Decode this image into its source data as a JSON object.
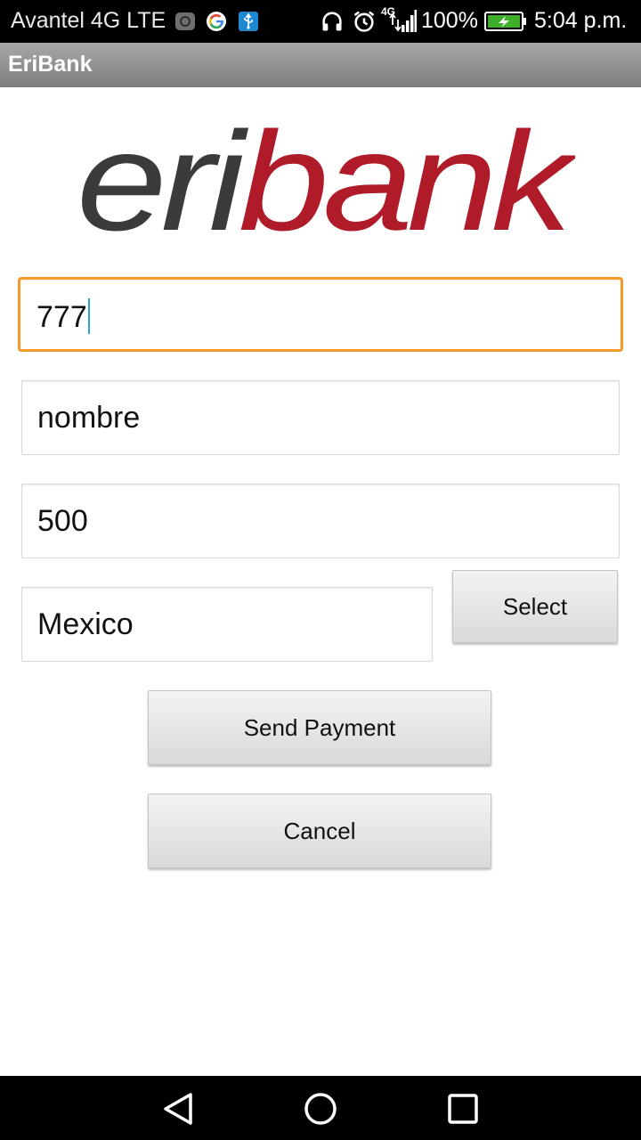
{
  "status_bar": {
    "carrier": "Avantel 4G LTE",
    "network_badge": "4G",
    "battery_percent": "100%",
    "time": "5:04 p.m.",
    "icons": [
      "notification-icon",
      "google-icon",
      "usb-icon",
      "headphones-icon",
      "alarm-icon",
      "signal-icon",
      "battery-charging-icon"
    ]
  },
  "action_bar": {
    "title": "EriBank"
  },
  "logo": {
    "text_dark": "eri",
    "text_red": "bank",
    "dark_color": "#3a3b3d",
    "red_color": "#b01b2a"
  },
  "form": {
    "phone_value": "777",
    "name_value": "nombre",
    "amount_value": "500",
    "country_value": "Mexico",
    "select_label": "Select",
    "send_label": "Send Payment",
    "cancel_label": "Cancel"
  },
  "colors": {
    "focus_border": "#f39b27",
    "caret": "#26a6c9"
  },
  "nav_bar": {
    "buttons": [
      "back-icon",
      "home-icon",
      "recents-icon"
    ]
  }
}
